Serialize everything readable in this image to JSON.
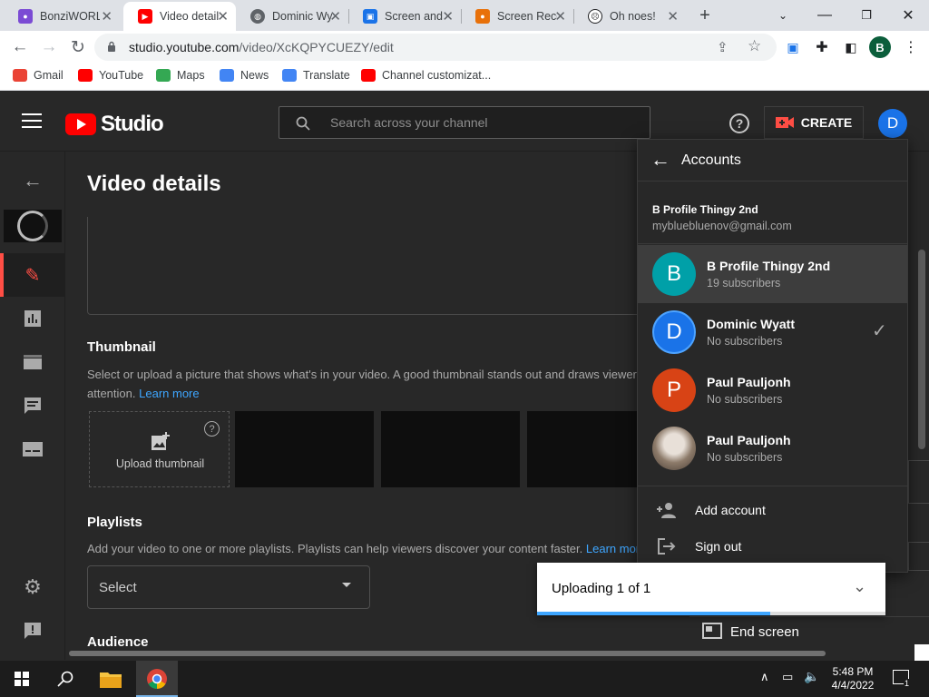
{
  "browser": {
    "tabs": [
      {
        "title": "BonziWORLD",
        "icon": "bonzi-icon",
        "color": "#7b4bd4"
      },
      {
        "title": "Video details",
        "icon": "youtube-icon",
        "color": "#ff0000"
      },
      {
        "title": "Dominic Wyatt",
        "icon": "globe-icon",
        "color": "#5f6368"
      },
      {
        "title": "Screen and",
        "icon": "screen-icon",
        "color": "#1a73e8"
      },
      {
        "title": "Screen Recorder",
        "icon": "recorder-icon",
        "color": "#e8710a"
      },
      {
        "title": "Oh noes!",
        "icon": "ohnoes-icon",
        "color": "#202124"
      }
    ],
    "url_host": "studio.youtube.com",
    "url_path": "/video/XcKQPYCUEZY/edit",
    "profile_initial": "B",
    "bookmarks": [
      {
        "label": "Gmail",
        "color": "#ea4335"
      },
      {
        "label": "YouTube",
        "color": "#ff0000"
      },
      {
        "label": "Maps",
        "color": "#34a853"
      },
      {
        "label": "News",
        "color": "#4285f4"
      },
      {
        "label": "Translate",
        "color": "#4285f4"
      },
      {
        "label": "Channel customizat...",
        "color": "#ff0000"
      }
    ]
  },
  "studio": {
    "logo_text": "Studio",
    "search_placeholder": "Search across your channel",
    "create_label": "CREATE",
    "avatar_initial": "D"
  },
  "main": {
    "page_title": "Video details",
    "thumbnail_heading": "Thumbnail",
    "thumbnail_desc": "Select or upload a picture that shows what's in your video. A good thumbnail stands out and draws viewers'",
    "thumbnail_desc2": "attention.",
    "learn_more": "Learn more",
    "upload_thumbnail": "Upload thumbnail",
    "playlists_heading": "Playlists",
    "playlists_desc": "Add your video to one or more playlists. Playlists can help viewers discover your content faster.",
    "learn_more_trunc": "Learn mor",
    "select_label": "Select",
    "audience_heading": "Audience",
    "end_screen": "End screen"
  },
  "accounts": {
    "title": "Accounts",
    "current_name": "B Profile Thingy 2nd",
    "current_email": "mybluebluenov@gmail.com",
    "items": [
      {
        "initial": "B",
        "name": "B Profile Thingy 2nd",
        "subs": "19 subscribers",
        "color": "#00a0a8",
        "checked": false
      },
      {
        "initial": "D",
        "name": "Dominic Wyatt",
        "subs": "No subscribers",
        "color": "#1a73e8",
        "checked": true
      },
      {
        "initial": "P",
        "name": "Paul Pauljonh",
        "subs": "No subscribers",
        "color": "#d84315",
        "checked": false
      },
      {
        "initial": "",
        "name": "Paul Pauljonh",
        "subs": "No subscribers",
        "color": "#8d7b6a",
        "checked": false
      }
    ],
    "add_account": "Add account",
    "sign_out": "Sign out"
  },
  "upload": {
    "label": "Uploading 1 of 1",
    "progress": 0.67
  },
  "taskbar": {
    "time": "5:48 PM",
    "date": "4/4/2022",
    "notification_count": "1"
  }
}
